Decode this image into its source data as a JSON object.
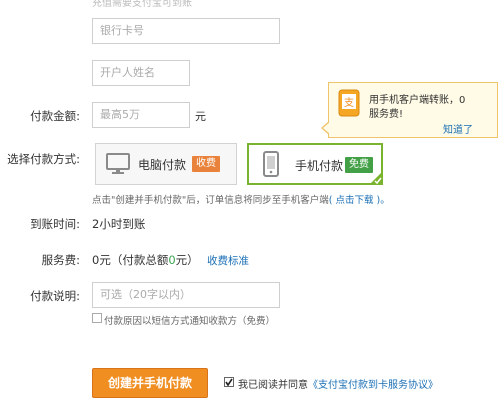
{
  "form": {
    "top_hint": "充值需要支付宝可到账",
    "bank_card": {
      "placeholder": "银行卡号"
    },
    "holder_name": {
      "placeholder": "开户人姓名"
    },
    "amount": {
      "label": "付款金额:",
      "placeholder": "最高5万",
      "unit": "元"
    },
    "method": {
      "label": "选择付款方式:",
      "pc": {
        "label": "电脑付款",
        "badge": "收费"
      },
      "mobile": {
        "label": "手机付款",
        "badge": "免费"
      }
    },
    "tooltip": {
      "text_line1": "用手机客户端转账，0",
      "text_line2": "服务费!",
      "dismiss": "知道了"
    },
    "mobile_note": "点击\"创建并手机付款\"后，订单信息将同步至手机客户端",
    "mobile_note_link": "( 点击下载 )。",
    "arrival": {
      "label": "到账时间:",
      "value": "2小时到账"
    },
    "fee": {
      "label": "服务费:",
      "value_prefix": "0元（付款总额",
      "value_zero": "0",
      "value_suffix": "元）",
      "standard_link": "收费标准"
    },
    "remark": {
      "label": "付款说明:",
      "placeholder": "可选（20字以内）"
    },
    "sms_notify": {
      "label": "付款原因以短信方式通知收款方（免费）",
      "checked": false
    },
    "submit": "创建并手机付款",
    "agree": {
      "checked": true,
      "text": "我已阅读并同意",
      "link": "《支付宝付款到卡服务协议》"
    }
  },
  "colors": {
    "accent_green": "#7ab32e",
    "badge_orange": "#f08e22",
    "link": "#1a6fb5"
  }
}
